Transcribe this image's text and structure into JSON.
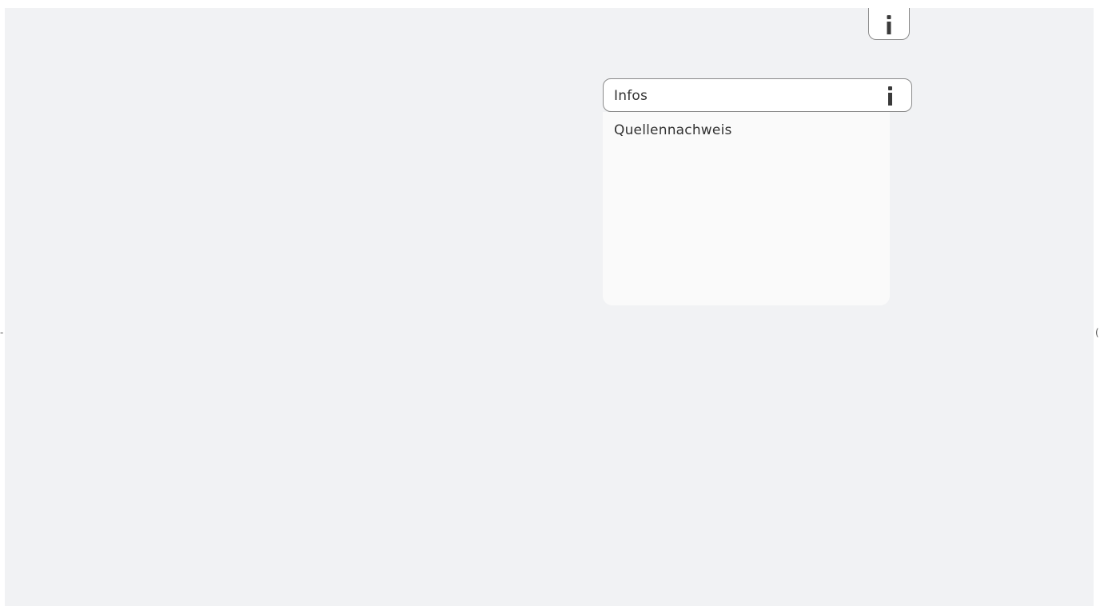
{
  "panel": {
    "title": "Infos",
    "items": [
      "Quellennachweis"
    ]
  },
  "icons": {
    "top_button": "info-icon",
    "panel_header": "info-icon"
  },
  "colors": {
    "background": "#f1f2f4",
    "panel": "#fafafa",
    "text": "#333333",
    "border": "#8a8a8a"
  }
}
